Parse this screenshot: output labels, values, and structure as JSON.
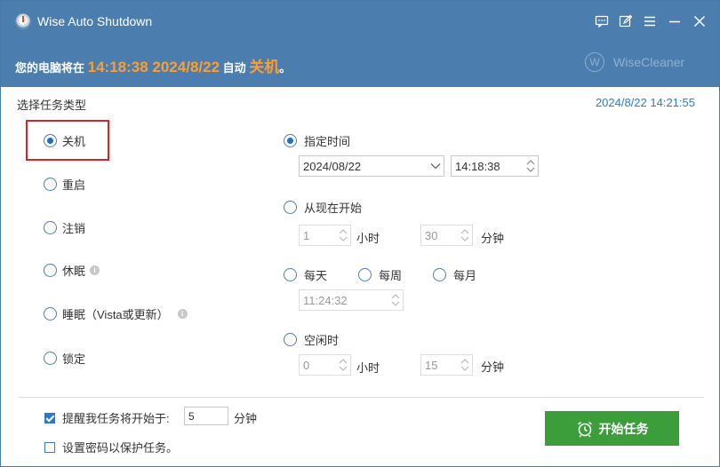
{
  "window": {
    "title": "Wise Auto Shutdown"
  },
  "banner": {
    "prefix": "您的电脑将在 ",
    "time": "14:18:38 2024/8/22",
    "middle": " 自动 ",
    "action": "关机",
    "suffix": "。",
    "logo_text": "WiseCleaner",
    "logo_letter": "W"
  },
  "task_type": {
    "title": "选择任务类型",
    "current_time": "2024/8/22 14:21:55",
    "options": [
      {
        "label": "关机",
        "checked": true
      },
      {
        "label": "重启",
        "checked": false
      },
      {
        "label": "注销",
        "checked": false
      },
      {
        "label": "休眠",
        "checked": false
      },
      {
        "label": "睡眠（Vista或更新）",
        "checked": false
      },
      {
        "label": "锁定",
        "checked": false
      }
    ]
  },
  "schedule": {
    "specific": {
      "label": "指定时间",
      "checked": true,
      "date": "2024/08/22",
      "time": "14:18:38"
    },
    "from_now": {
      "label": "从现在开始",
      "checked": false,
      "hours": "1",
      "hours_unit": "小时",
      "minutes": "30",
      "minutes_unit": "分钟"
    },
    "daily": {
      "label": "每天",
      "checked": false
    },
    "weekly": {
      "label": "每周",
      "checked": false
    },
    "monthly": {
      "label": "每月",
      "checked": false
    },
    "repeat_time": "11:24:32",
    "idle": {
      "label": "空闲时",
      "checked": false,
      "hours": "0",
      "hours_unit": "小时",
      "minutes": "15",
      "minutes_unit": "分钟"
    }
  },
  "footer": {
    "remind_label": "提醒我任务将开始于:",
    "remind_checked": true,
    "remind_value": "5",
    "remind_unit": "分钟",
    "password_label": "设置密码以保护任务。",
    "password_checked": false,
    "start_button": "开始任务"
  },
  "colors": {
    "title_bar": "#4b7eae",
    "highlight_orange": "#ff9d2e",
    "start_button": "#3c9e3a",
    "time_blue": "#2b7bd0",
    "annotation_red": "#d9222a"
  }
}
